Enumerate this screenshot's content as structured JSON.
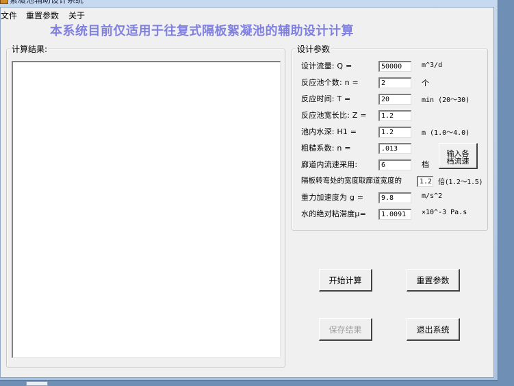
{
  "window": {
    "title": "絮凝池辅助设计系统"
  },
  "menu": [
    "文件",
    "重置参数",
    "关于"
  ],
  "heading": "本系统目前仅适用于往复式隔板絮凝池的辅助设计计算",
  "results": {
    "caption": "计算结果:",
    "text": ""
  },
  "params": {
    "caption": "设计参数",
    "rows": [
      {
        "label": "设计流量: Q =",
        "value": "50000",
        "unit": "m^3/d"
      },
      {
        "label": "反应池个数: n =",
        "value": "2",
        "unit": "个"
      },
      {
        "label": "反应时间: T =",
        "value": "20",
        "unit": "min (20～30)"
      },
      {
        "label": "反应池宽长比: Z =",
        "value": "1.2",
        "unit": ""
      },
      {
        "label": "池内水深: H1 =",
        "value": "1.2",
        "unit": "m (1.0～4.0)"
      },
      {
        "label": "粗糙系数: n =",
        "value": ".013",
        "unit": ""
      },
      {
        "label": "廊道内流速采用:",
        "value": "6",
        "unit": "档"
      },
      {
        "label": "隔板转弯处的宽度取廊道宽度的",
        "value": "1.2",
        "unit": "倍(1.2～1.5)"
      },
      {
        "label": "重力加速度为 g =",
        "value": "9.8",
        "unit": "m/s^2"
      },
      {
        "label": "水的绝对粘滞度μ=",
        "value": "1.0091",
        "unit": "×10^-3 Pa.s"
      }
    ],
    "input_speed_button": [
      "输入各",
      "档流速"
    ]
  },
  "buttons": {
    "start": "开始计算",
    "reset": "重置参数",
    "save": "保存结果",
    "exit": "退出系统"
  },
  "colors": {
    "heading": "#8080e0",
    "form_bg": "#f0f0f0",
    "frame": "#a9c3e2"
  }
}
